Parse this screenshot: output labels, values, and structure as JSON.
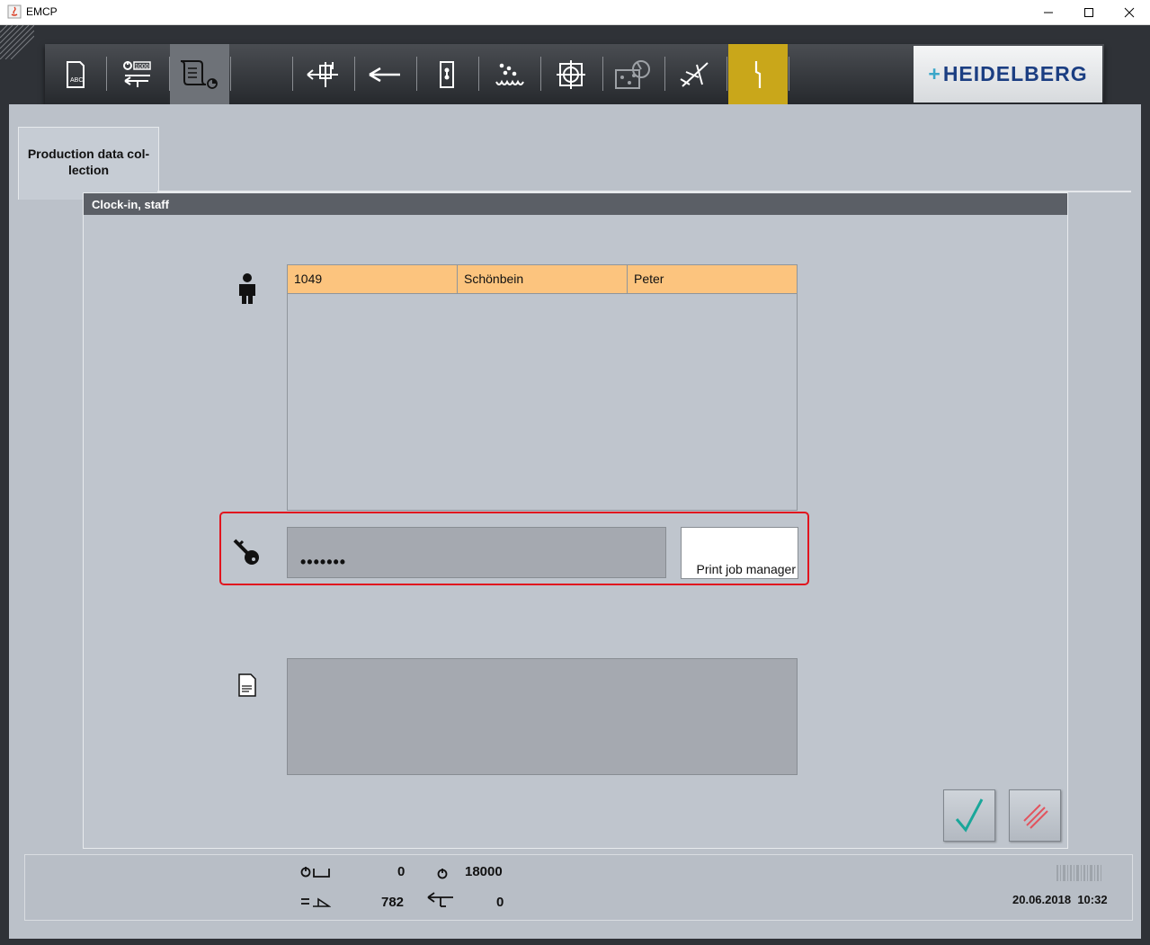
{
  "window": {
    "title": "EMCP"
  },
  "toolbar": {
    "buttons": [
      {
        "icon": "job-data-abc-icon"
      },
      {
        "icon": "counter-feed-icon"
      },
      {
        "icon": "production-data-icon",
        "selected": true
      },
      {
        "icon": "feeder-icon"
      },
      {
        "icon": "transport-icon"
      },
      {
        "icon": "printing-unit-icon"
      },
      {
        "icon": "dampening-icon"
      },
      {
        "icon": "register-icon"
      },
      {
        "icon": "color-profile-icon"
      },
      {
        "icon": "diagnostic-icon"
      },
      {
        "icon": "alert-icon",
        "highlight": "#c9a71a"
      }
    ],
    "logo": "HEIDELBERG"
  },
  "tab": {
    "label": "Production data collection"
  },
  "dialog": {
    "title": "Clock-in, staff",
    "staff_table": {
      "rows": [
        {
          "id": "1049",
          "last_name": "Schönbein",
          "first_name": "Peter"
        }
      ]
    },
    "password": {
      "value": "•••••••"
    },
    "print_job_manager_label": "Print job manager",
    "note": ""
  },
  "status": {
    "counter_a": "0",
    "counter_b": "18000",
    "counter_c": "782",
    "counter_d": "0",
    "date": "20.06.2018",
    "time": "10:32"
  },
  "colors": {
    "selected_row": "#fcc47e",
    "alert_button": "#c9a71a",
    "highlight_frame": "#e1141e",
    "confirm_check": "#1aa79a",
    "cancel_mark": "#e2545e"
  }
}
